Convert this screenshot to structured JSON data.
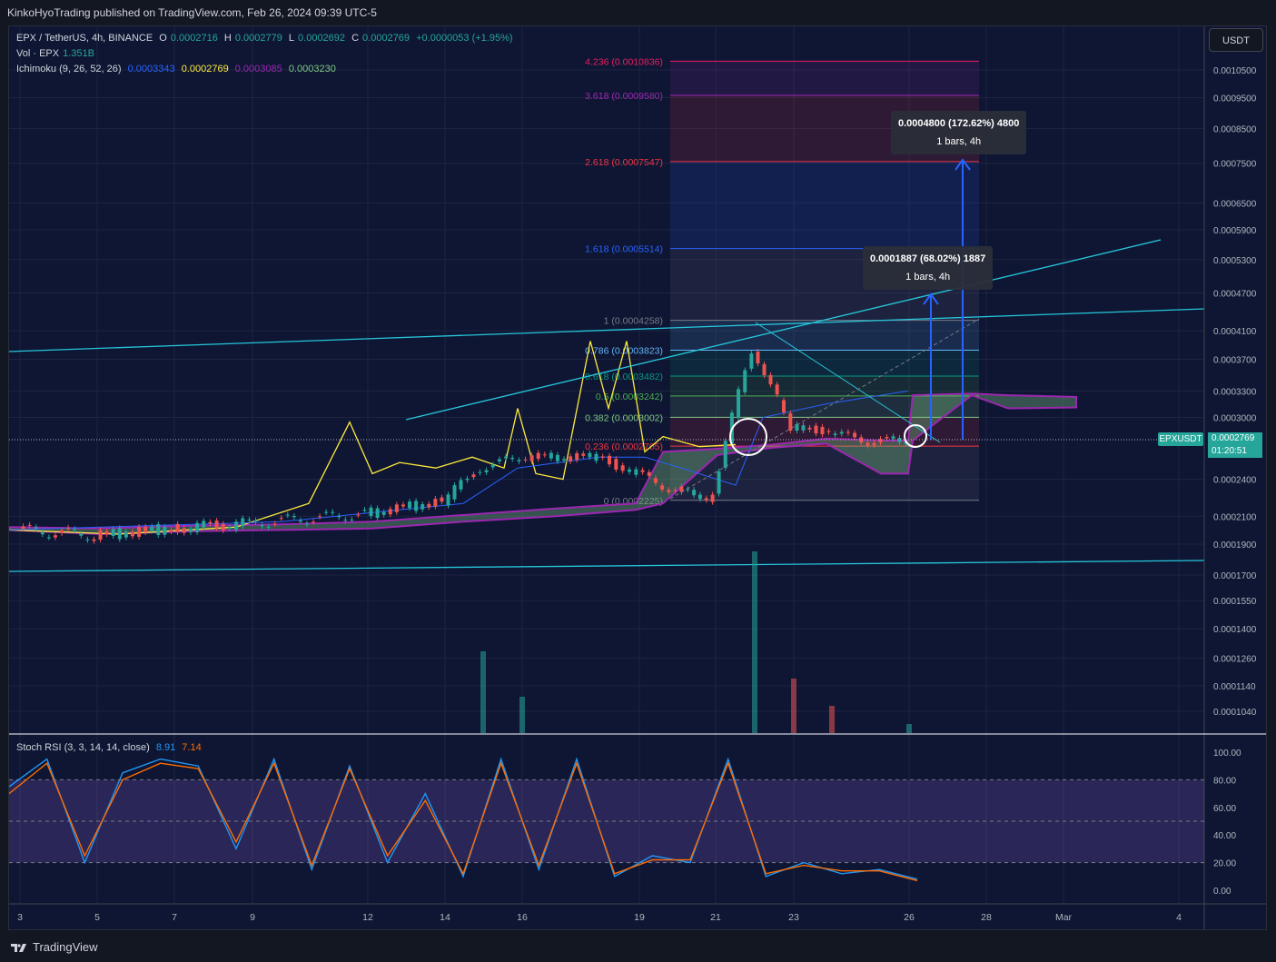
{
  "header": {
    "publisher_line": "KinkoHyoTrading published on TradingView.com, Feb 26, 2024 09:39 UTC-5"
  },
  "legend": {
    "symbol": "EPX / TetherUS, 4h, BINANCE",
    "o_label": "O",
    "o": "0.0002716",
    "h_label": "H",
    "h": "0.0002779",
    "l_label": "L",
    "l": "0.0002692",
    "c_label": "C",
    "c": "0.0002769",
    "change": "+0.0000053 (+1.95%)",
    "vol_label": "Vol · EPX",
    "vol": "1.351B",
    "ichimoku_label": "Ichimoku (9, 26, 52, 26)",
    "ichimoku_values": [
      "0.0003343",
      "0.0002769",
      "0.0003085",
      "0.0003230"
    ],
    "stoch_label": "Stoch RSI (3, 3, 14, 14, close)",
    "stoch_k": "8.91",
    "stoch_d": "7.14"
  },
  "currency_button": "USDT",
  "price_tag": {
    "symbol": "EPXUSDT",
    "price": "0.0002769",
    "countdown": "01:20:51"
  },
  "tooltips": [
    {
      "line1": "0.0004800 (172.62%) 4800",
      "line2": "1 bars, 4h"
    },
    {
      "line1": "0.0001887 (68.02%) 1887",
      "line2": "1 bars, 4h"
    }
  ],
  "fib_levels": [
    {
      "ratio": "4.236",
      "label": "4.236 (0.0010836)",
      "price": 0.0010836,
      "color": "#e91e63"
    },
    {
      "ratio": "3.618",
      "label": "3.618 (0.0009580)",
      "price": 0.000958,
      "color": "#9c27b0"
    },
    {
      "ratio": "2.618",
      "label": "2.618 (0.0007547)",
      "price": 0.0007547,
      "color": "#f23645"
    },
    {
      "ratio": "1.618",
      "label": "1.618 (0.0005514)",
      "price": 0.0005514,
      "color": "#2962ff"
    },
    {
      "ratio": "1",
      "label": "1 (0.0004258)",
      "price": 0.0004258,
      "color": "#787b86"
    },
    {
      "ratio": "0.786",
      "label": "0.786 (0.0003823)",
      "price": 0.0003823,
      "color": "#64b5f6"
    },
    {
      "ratio": "0.618",
      "label": "0.618 (0.0003482)",
      "price": 0.0003482,
      "color": "#089981"
    },
    {
      "ratio": "0.5",
      "label": "0.5 (0.0003242)",
      "price": 0.0003242,
      "color": "#4caf50"
    },
    {
      "ratio": "0.382",
      "label": "0.382 (0.0003002)",
      "price": 0.0003002,
      "color": "#81c784"
    },
    {
      "ratio": "0.236",
      "label": "0.236 (0.0002705)",
      "price": 0.0002705,
      "color": "#f23645"
    },
    {
      "ratio": "0",
      "label": "0 (0.0002225)",
      "price": 0.0002225,
      "color": "#787b86"
    }
  ],
  "chart_data": [
    {
      "type": "candlestick",
      "title": "EPX / TetherUS, 4h, BINANCE",
      "y_scale": "log",
      "ylim": [
        0.0001,
        0.0011
      ],
      "y_ticks": [
        "0.0010500",
        "0.0009500",
        "0.0008500",
        "0.0007500",
        "0.0006500",
        "0.0005900",
        "0.0005300",
        "0.0004700",
        "0.0004100",
        "0.0003700",
        "0.0003300",
        "0.0003000",
        "0.0002400",
        "0.0002100",
        "0.0001900",
        "0.0001700",
        "0.0001550",
        "0.0001400",
        "0.0001260",
        "0.0001140",
        "0.0001040"
      ],
      "x_ticks": [
        "3",
        "5",
        "7",
        "9",
        "12",
        "14",
        "16",
        "19",
        "21",
        "23",
        "26",
        "28",
        "Mar",
        "4"
      ],
      "close_points": [
        {
          "x": "3",
          "y": 0.0002
        },
        {
          "x": "5",
          "y": 0.000196
        },
        {
          "x": "7",
          "y": 0.000201
        },
        {
          "x": "9",
          "y": 0.000205
        },
        {
          "x": "12",
          "y": 0.000212
        },
        {
          "x": "14",
          "y": 0.000222
        },
        {
          "x": "15",
          "y": 0.00025
        },
        {
          "x": "16",
          "y": 0.00026
        },
        {
          "x": "18",
          "y": 0.00026
        },
        {
          "x": "19",
          "y": 0.000245
        },
        {
          "x": "20",
          "y": 0.00023
        },
        {
          "x": "21",
          "y": 0.000225
        },
        {
          "x": "22",
          "y": 0.00038
        },
        {
          "x": "22.5",
          "y": 0.00034
        },
        {
          "x": "23",
          "y": 0.00029
        },
        {
          "x": "24",
          "y": 0.000285
        },
        {
          "x": "25",
          "y": 0.000275
        },
        {
          "x": "26",
          "y": 0.0002769
        }
      ],
      "volume_bars": [
        {
          "x": "15",
          "v": 0.45
        },
        {
          "x": "16",
          "v": 0.2
        },
        {
          "x": "22",
          "v": 1.0
        },
        {
          "x": "23",
          "v": 0.3
        },
        {
          "x": "24",
          "v": 0.15
        },
        {
          "x": "26",
          "v": 0.05
        }
      ]
    },
    {
      "type": "line",
      "title": "Stoch RSI (3, 3, 14, 14, close)",
      "ylim": [
        0,
        100
      ],
      "y_ticks": [
        "100.00",
        "80.00",
        "60.00",
        "40.00",
        "20.00",
        "0.00"
      ],
      "series": [
        {
          "name": "8.91",
          "values": [
            75,
            95,
            20,
            85,
            95,
            90,
            30,
            95,
            15,
            90,
            20,
            70,
            10,
            95,
            15,
            95,
            10,
            25,
            20,
            95,
            10,
            20,
            12,
            15,
            8
          ]
        },
        {
          "name": "7.14",
          "values": [
            70,
            92,
            25,
            80,
            92,
            88,
            35,
            92,
            18,
            88,
            25,
            65,
            12,
            92,
            18,
            92,
            12,
            22,
            22,
            92,
            12,
            18,
            14,
            14,
            7
          ]
        }
      ]
    }
  ]
}
